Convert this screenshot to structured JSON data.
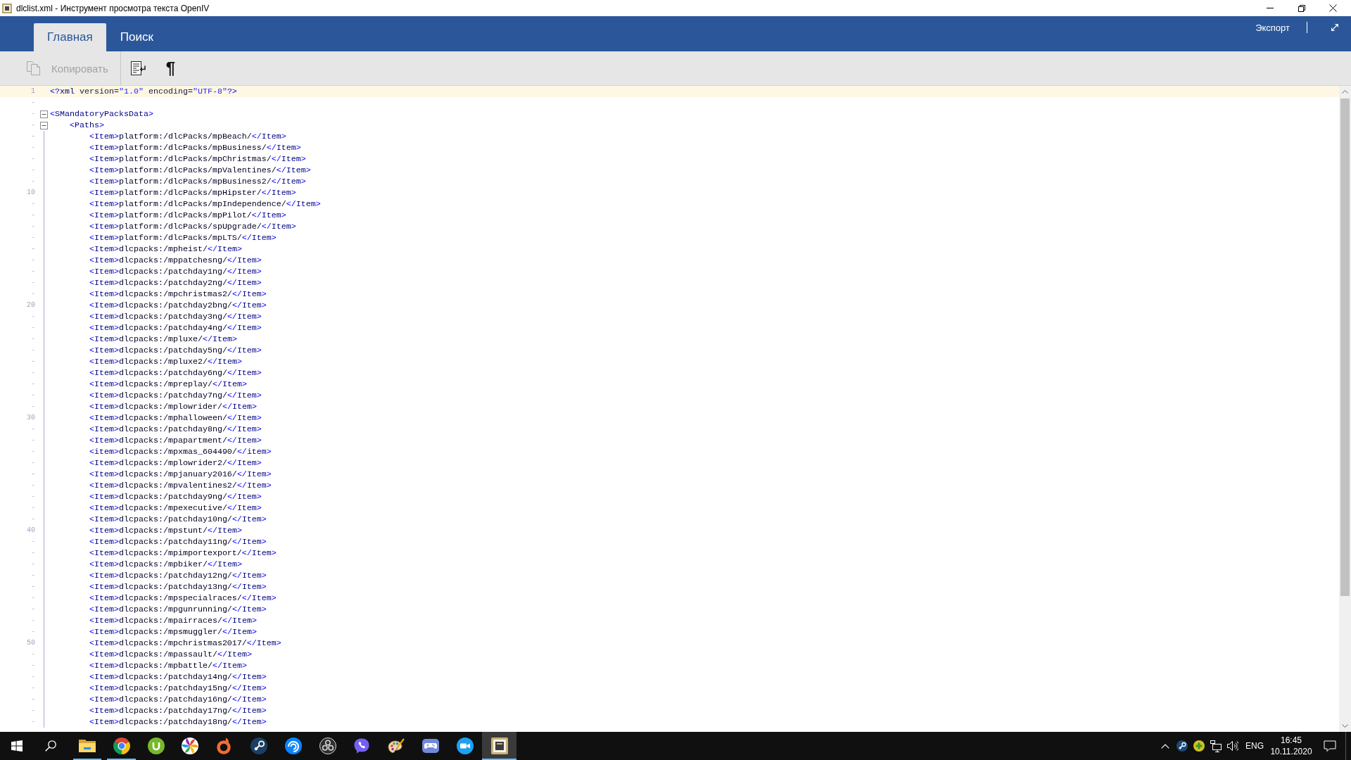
{
  "window": {
    "title": "dlclist.xml - Инструмент просмотра текста OpenIV"
  },
  "ribbon": {
    "tabs": [
      {
        "label": "Главная",
        "selected": true
      },
      {
        "label": "Поиск",
        "selected": false
      }
    ],
    "export": "Экспорт"
  },
  "toolbar": {
    "buttons": [
      {
        "kind": "copy",
        "label": "Копировать",
        "disabled": true
      },
      {
        "kind": "wrap"
      },
      {
        "kind": "pilcrow",
        "label": "¶"
      }
    ]
  },
  "editor": {
    "lines": [
      {
        "number": "1",
        "text": "<?xml version=\"1.0\" encoding=\"UTF-8\"?>",
        "current": true
      },
      {
        "mark": "-"
      },
      {
        "mark": "-",
        "text": "<SMandatoryPacksData>",
        "expanded": true,
        "children": [
          {
            "mark": "-",
            "text": "<Paths>",
            "expanded": true,
            "children": [
              {
                "mark": "–",
                "text": "<Item>platform:/dlcPacks/mpBeach/</Item>"
              },
              {
                "mark": "-",
                "text": "<Item>platform:/dlcPacks/mpBusiness/</Item>"
              },
              {
                "mark": "-",
                "text": "<Item>platform:/dlcPacks/mpChristmas/</Item>"
              },
              {
                "mark": "-",
                "text": "<Item>platform:/dlcPacks/mpValentines/</Item>"
              },
              {
                "mark": "-",
                "text": "<Item>platform:/dlcPacks/mpBusiness2/</Item>"
              },
              {
                "number": "10",
                "text": "<Item>platform:/dlcPacks/mpHipster/</Item>"
              },
              {
                "mark": "-",
                "text": "<Item>platform:/dlcPacks/mpIndependence/</Item>"
              },
              {
                "mark": "-",
                "text": "<Item>platform:/dlcPacks/mpPilot/</Item>"
              },
              {
                "mark": "-",
                "text": "<Item>platform:/dlcPacks/spUpgrade/</Item>"
              },
              {
                "mark": "-",
                "text": "<Item>platform:/dlcPacks/mpLTS/</Item>"
              },
              {
                "mark": "–",
                "text": "<Item>dlcpacks:/mpheist/</Item>"
              },
              {
                "mark": "-",
                "text": "<Item>dlcpacks:/mppatchesng/</Item>"
              },
              {
                "mark": "-",
                "text": "<Item>dlcpacks:/patchday1ng/</Item>"
              },
              {
                "mark": "-",
                "text": "<Item>dlcpacks:/patchday2ng/</Item>"
              },
              {
                "mark": "-",
                "text": "<Item>dlcpacks:/mpchristmas2/</Item>"
              },
              {
                "number": "20",
                "text": "<Item>dlcpacks:/patchday2bng/</Item>"
              },
              {
                "mark": "-",
                "text": "<Item>dlcpacks:/patchday3ng/</Item>"
              },
              {
                "mark": "-",
                "text": "<Item>dlcpacks:/patchday4ng/</Item>"
              },
              {
                "mark": "-",
                "text": "<Item>dlcpacks:/mpluxe/</Item>"
              },
              {
                "mark": "-",
                "text": "<Item>dlcpacks:/patchday5ng/</Item>"
              },
              {
                "mark": "–",
                "text": "<Item>dlcpacks:/mpluxe2/</Item>"
              },
              {
                "mark": "-",
                "text": "<Item>dlcpacks:/patchday6ng/</Item>"
              },
              {
                "mark": "-",
                "text": "<Item>dlcpacks:/mpreplay/</Item>"
              },
              {
                "mark": "-",
                "text": "<Item>dlcpacks:/patchday7ng/</Item>"
              },
              {
                "mark": "-",
                "text": "<Item>dlcpacks:/mplowrider/</Item>"
              },
              {
                "number": "30",
                "text": "<Item>dlcpacks:/mphalloween/</Item>"
              },
              {
                "mark": "-",
                "text": "<Item>dlcpacks:/patchday8ng/</Item>"
              },
              {
                "mark": "-",
                "text": "<Item>dlcpacks:/mpapartment/</Item>"
              },
              {
                "mark": "-",
                "text": "<item>dlcpacks:/mpxmas_604490/</item>"
              },
              {
                "mark": "-",
                "text": "<Item>dlcpacks:/mplowrider2/</Item>"
              },
              {
                "mark": "–",
                "text": "<Item>dlcpacks:/mpjanuary2016/</Item>"
              },
              {
                "mark": "-",
                "text": "<Item>dlcpacks:/mpvalentines2/</Item>"
              },
              {
                "mark": "-",
                "text": "<Item>dlcpacks:/patchday9ng/</Item>"
              },
              {
                "mark": "-",
                "text": "<Item>dlcpacks:/mpexecutive/</Item>"
              },
              {
                "mark": "-",
                "text": "<Item>dlcpacks:/patchday10ng/</Item>"
              },
              {
                "number": "40",
                "text": "<Item>dlcpacks:/mpstunt/</Item>"
              },
              {
                "mark": "-",
                "text": "<Item>dlcpacks:/patchday11ng/</Item>"
              },
              {
                "mark": "-",
                "text": "<Item>dlcpacks:/mpimportexport/</Item>"
              },
              {
                "mark": "-",
                "text": "<Item>dlcpacks:/mpbiker/</Item>"
              },
              {
                "mark": "-",
                "text": "<Item>dlcpacks:/patchday12ng/</Item>"
              },
              {
                "mark": "–",
                "text": "<Item>dlcpacks:/patchday13ng/</Item>"
              },
              {
                "mark": "-",
                "text": "<Item>dlcpacks:/mpspecialraces/</Item>"
              },
              {
                "mark": "-",
                "text": "<Item>dlcpacks:/mpgunrunning/</Item>"
              },
              {
                "mark": "-",
                "text": "<Item>dlcpacks:/mpairraces/</Item>"
              },
              {
                "mark": "-",
                "text": "<Item>dlcpacks:/mpsmuggler/</Item>"
              },
              {
                "number": "50",
                "text": "<Item>dlcpacks:/mpchristmas2017/</Item>"
              },
              {
                "mark": "-",
                "text": "<Item>dlcpacks:/mpassault/</Item>"
              },
              {
                "mark": "-",
                "text": "<Item>dlcpacks:/mpbattle/</Item>"
              },
              {
                "mark": "-",
                "text": "<Item>dlcpacks:/patchday14ng/</Item>"
              },
              {
                "mark": "-",
                "text": "<Item>dlcpacks:/patchday15ng/</Item>"
              },
              {
                "mark": "–",
                "text": "<Item>dlcpacks:/patchday16ng/</Item>"
              },
              {
                "mark": "-",
                "text": "<Item>dlcpacks:/patchday17ng/</Item>"
              },
              {
                "mark": "-",
                "text": "<Item>dlcpacks:/patchday18ng/</Item>"
              }
            ]
          }
        ]
      }
    ]
  },
  "taskbar": {
    "apps": [
      {
        "kind": "folder",
        "running": true,
        "selected": false
      },
      {
        "kind": "ring",
        "running": true,
        "selected": false
      },
      {
        "kind": "cup",
        "running": false,
        "selected": false
      },
      {
        "kind": "pinwheel",
        "running": false,
        "selected": false
      },
      {
        "kind": "flame",
        "running": false,
        "selected": false
      },
      {
        "kind": "linkage",
        "running": false,
        "selected": false
      },
      {
        "kind": "swirl",
        "running": false,
        "selected": false
      },
      {
        "kind": "lens",
        "running": false,
        "selected": false
      },
      {
        "kind": "bubble",
        "running": false,
        "selected": false
      },
      {
        "kind": "palette",
        "running": false,
        "selected": false
      },
      {
        "kind": "gamepad",
        "running": false,
        "selected": false
      },
      {
        "kind": "camera",
        "running": false,
        "selected": false
      },
      {
        "kind": "tile",
        "running": true,
        "selected": true
      }
    ],
    "tray": {
      "language": "ENG",
      "time": "16:45",
      "date": "10.11.2020"
    }
  }
}
